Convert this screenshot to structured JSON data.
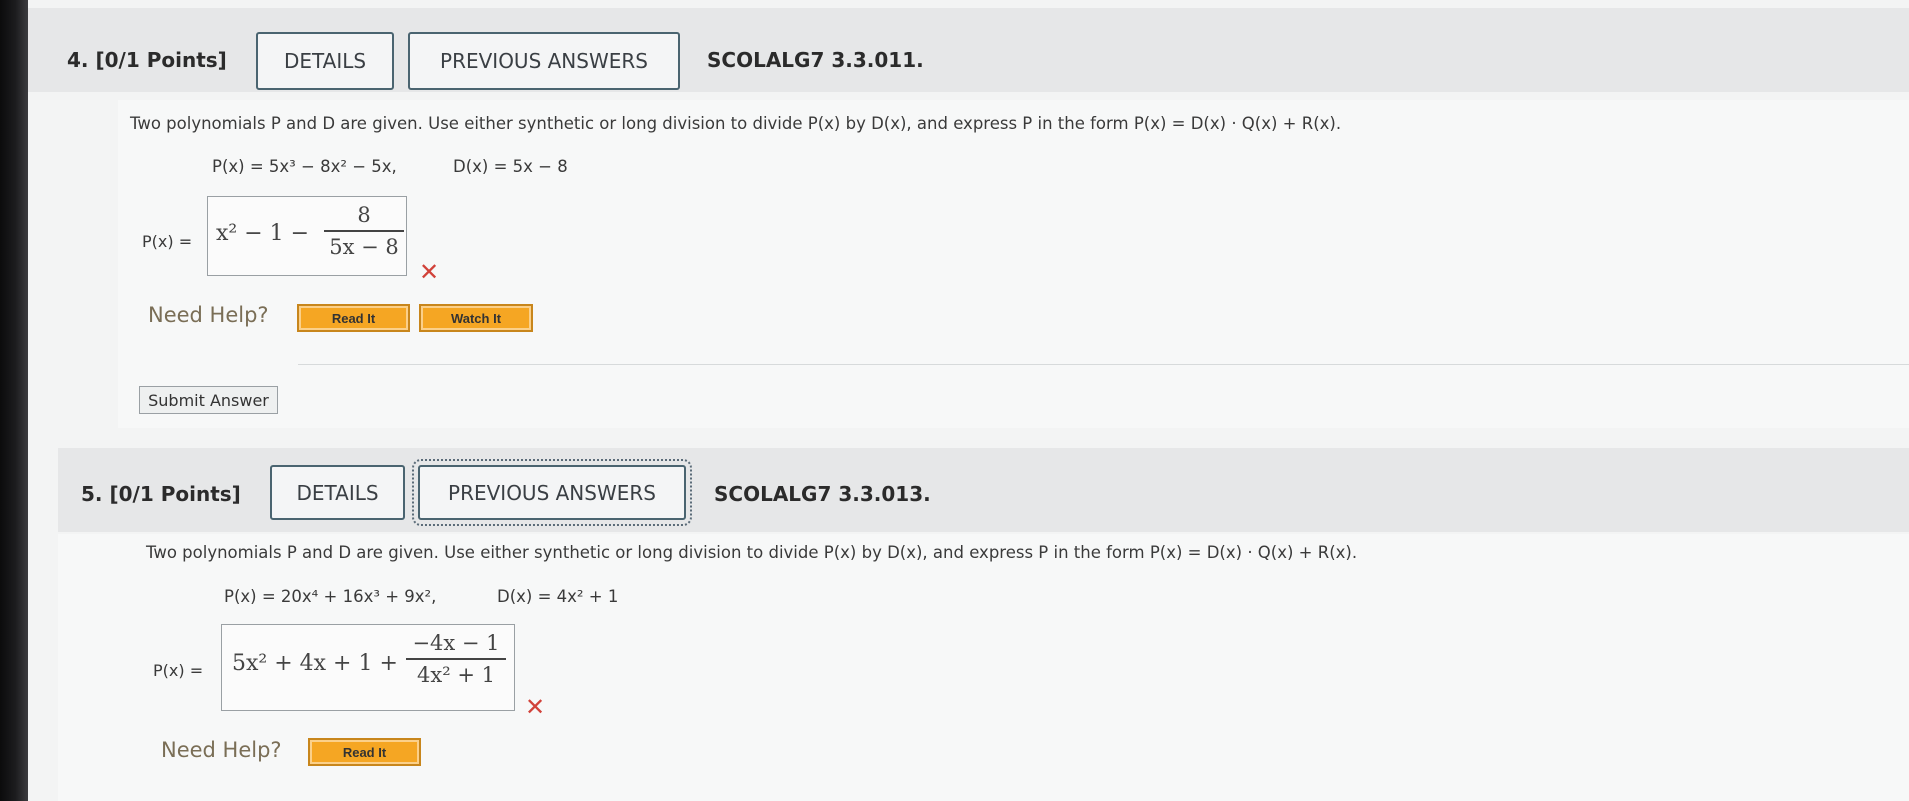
{
  "q4": {
    "number": "4. [0/1 Points]",
    "details_label": "DETAILS",
    "previous_answers_label": "PREVIOUS ANSWERS",
    "code": "SCOLALG7 3.3.011.",
    "given_p": "P(x) = 5x³ − 8x² − 5x,",
    "given_d": "D(x) = 5x − 8",
    "answer_label": "P(x) =",
    "answer_whole": "x² − 1 −",
    "answer_num": "8",
    "answer_den": "5x − 8",
    "result_mark": "✕",
    "need_help": "Need Help?",
    "read_it": "Read It",
    "watch_it": "Watch It",
    "submit_label": "Submit Answer"
  },
  "q5": {
    "number": "5. [0/1 Points]",
    "details_label": "DETAILS",
    "previous_answers_label": "PREVIOUS ANSWERS",
    "code": "SCOLALG7 3.3.013.",
    "given_p": "P(x) = 20x⁴ + 16x³ + 9x²,",
    "given_d": "D(x) = 4x² + 1",
    "answer_label": "P(x) =",
    "answer_whole": "5x² + 4x + 1 +",
    "answer_num": "−4x − 1",
    "answer_den": "4x² + 1",
    "result_mark": "✕",
    "need_help": "Need Help?",
    "read_it": "Read It"
  },
  "prompt_text": "Two polynomials P and D are given. Use either synthetic or long division to divide P(x) by D(x), and express P in the form P(x) = D(x) · Q(x) + R(x)."
}
